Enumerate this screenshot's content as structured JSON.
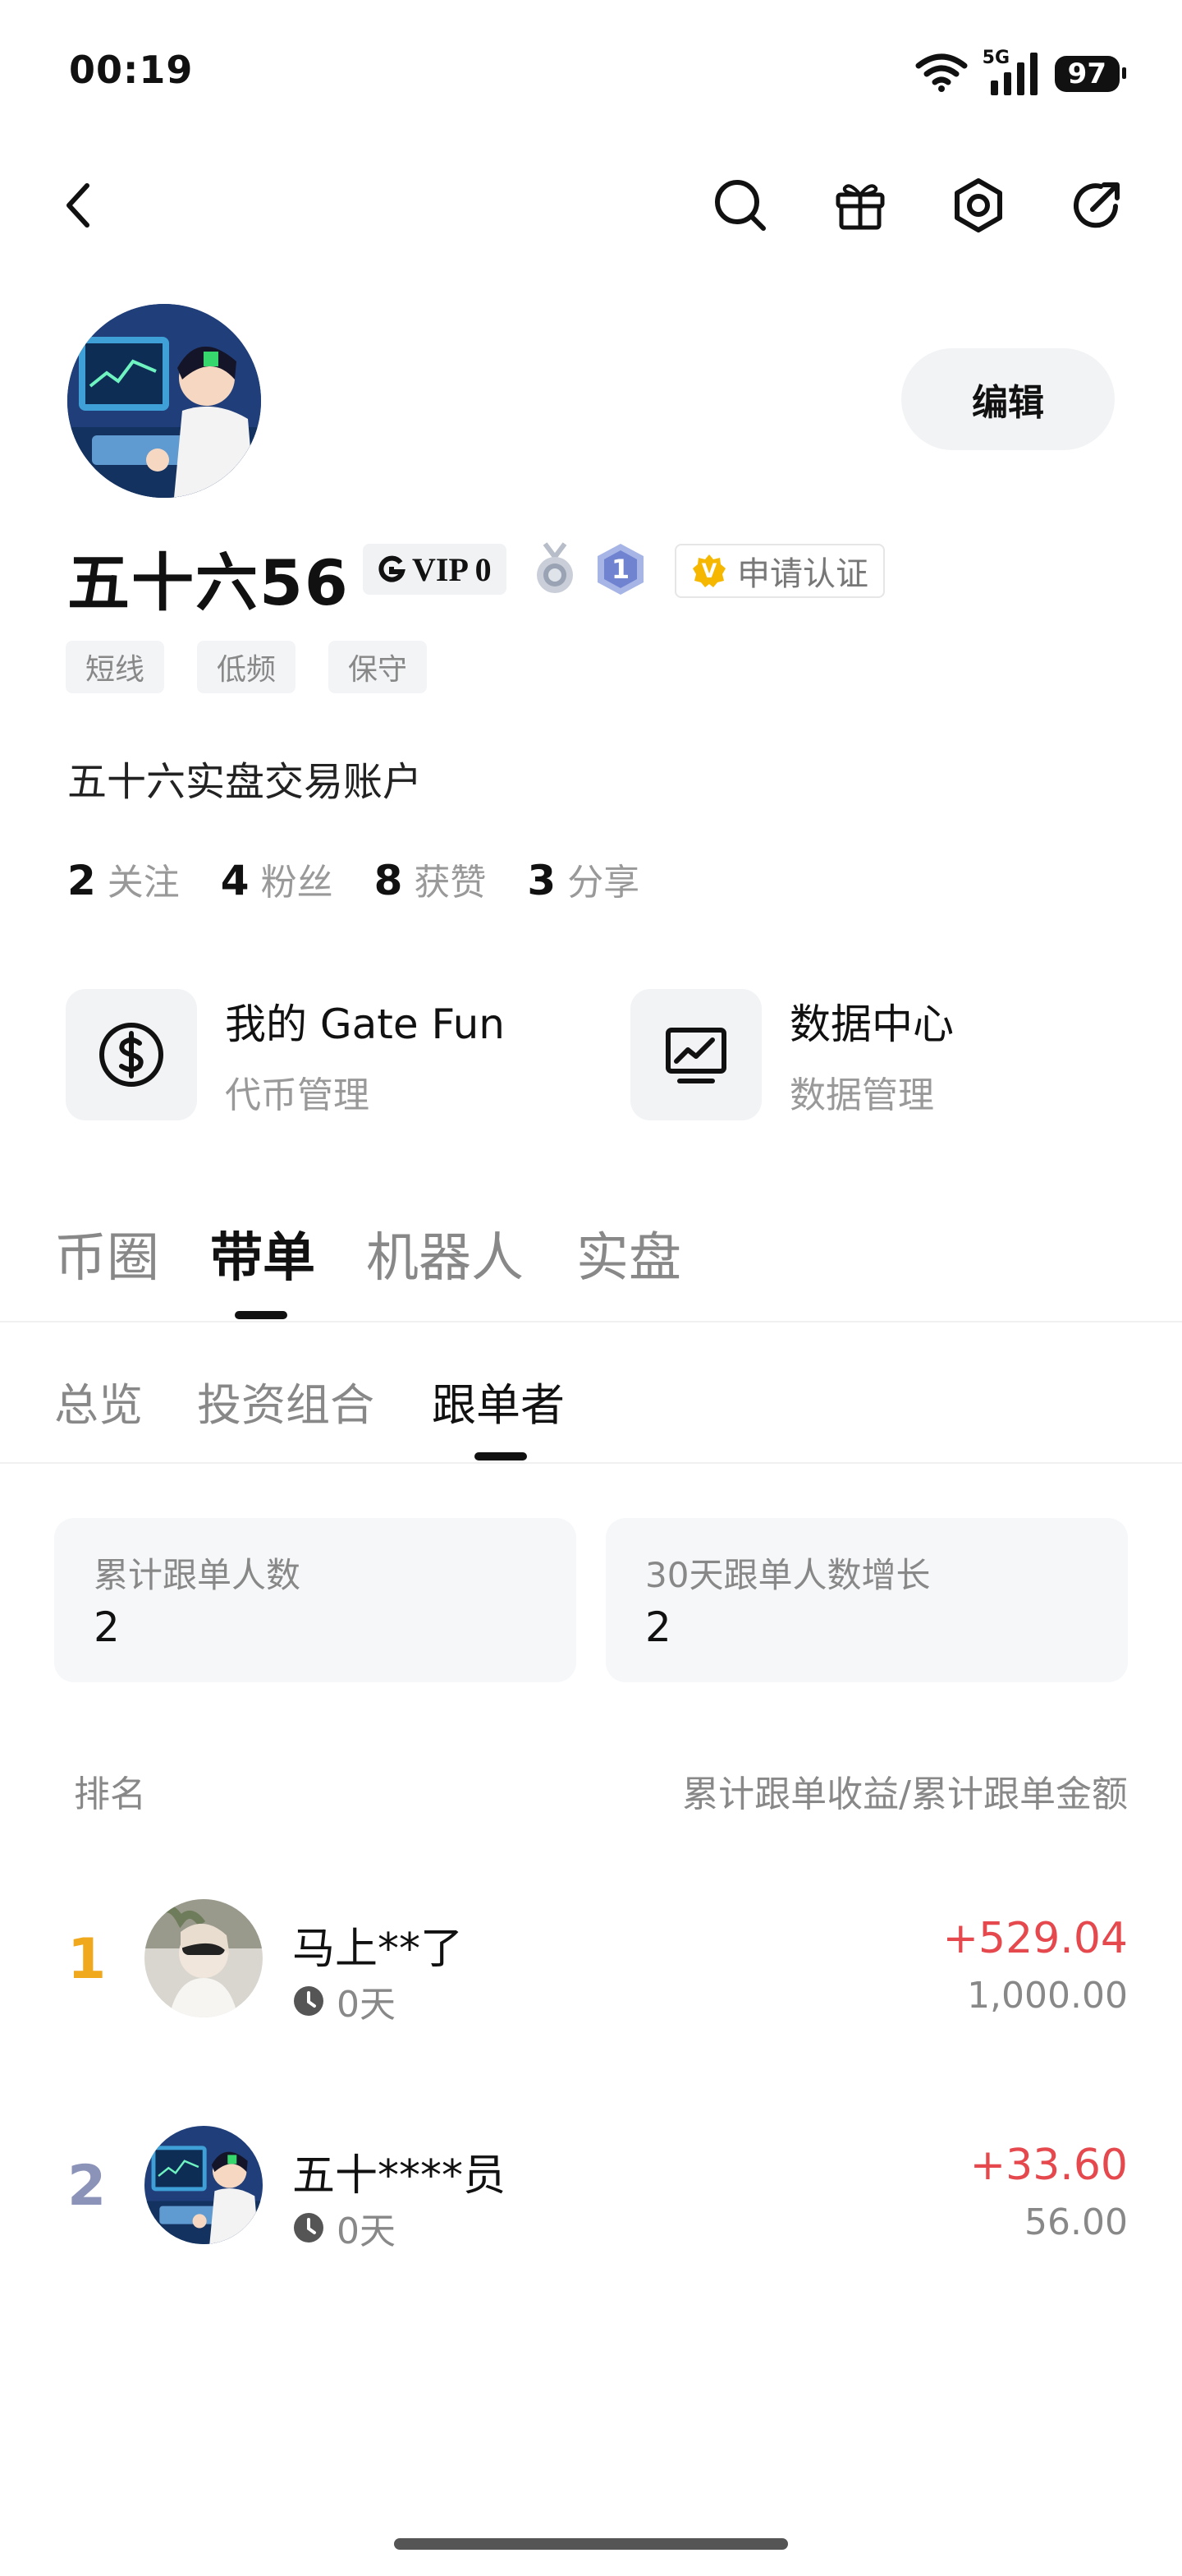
{
  "status_bar": {
    "time": "00:19",
    "network": "5G",
    "battery": "97"
  },
  "profile": {
    "username": "五十六56",
    "vip": "VIP 0",
    "medal_level": "1",
    "verify_label": "申请认证",
    "verify_badge": "V",
    "edit_label": "编辑",
    "tags": [
      "短线",
      "低频",
      "保守"
    ],
    "bio": "五十六实盘交易账户",
    "stats": [
      {
        "num": "2",
        "label": "关注"
      },
      {
        "num": "4",
        "label": "粉丝"
      },
      {
        "num": "8",
        "label": "获赞"
      },
      {
        "num": "3",
        "label": "分享"
      }
    ]
  },
  "cards": [
    {
      "title": "我的 Gate Fun",
      "subtitle": "代币管理",
      "icon": "dollar-coin-icon"
    },
    {
      "title": "数据中心",
      "subtitle": "数据管理",
      "icon": "chart-monitor-icon"
    }
  ],
  "main_tabs": [
    "币圈",
    "带单",
    "机器人",
    "实盘"
  ],
  "sub_tabs": [
    "总览",
    "投资组合",
    "跟单者"
  ],
  "summary": [
    {
      "label": "累计跟单人数",
      "value": "2"
    },
    {
      "label": "30天跟单人数增长",
      "value": "2"
    }
  ],
  "table": {
    "header_left": "排名",
    "header_right": "累计跟单收益/累计跟单金额",
    "rows": [
      {
        "rank": "1",
        "name": "马上**了",
        "days": "0天",
        "profit": "+529.04",
        "amount": "1,000.00"
      },
      {
        "rank": "2",
        "name": "五十****员",
        "days": "0天",
        "profit": "+33.60",
        "amount": "56.00"
      }
    ]
  },
  "colors": {
    "profit": "#e5484d",
    "rank_1": "#f0a81c",
    "rank_2": "#8b93b8",
    "verify_badge": "#f5b700"
  }
}
